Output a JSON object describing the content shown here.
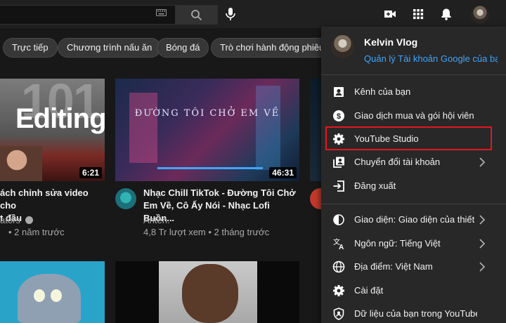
{
  "header": {
    "icons": [
      "keyboard-icon",
      "search-icon",
      "mic-icon",
      "create-video-icon",
      "apps-icon",
      "notifications-icon",
      "avatar"
    ]
  },
  "chips": [
    "Trực tiếp",
    "Chương trình nấu ăn",
    "Bóng đá",
    "Trò chơi hành động phiêu lưu"
  ],
  "videos": [
    {
      "thumb_text": "Editing",
      "thumb_big": "101",
      "duration": "6:21",
      "title_line1": "ách chỉnh sửa video cho",
      "title_line2": "t đầu",
      "channel": "ators",
      "meta": "• 2 năm trước"
    },
    {
      "thumb_text": "ĐƯỜNG TÔI CHỞ EM VỀ",
      "duration": "46:31",
      "title_line1": "Nhạc Chill TikTok - Đường Tôi Chở",
      "title_line2": "Em Về, Cô Ấy Nói - Nhạc Lofi Buồn...",
      "channel": "Anten.",
      "meta": "4,8 Tr lượt xem • 2 tháng trước"
    }
  ],
  "menu": {
    "name": "Kelvin Vlog",
    "manage": "Quản lý Tài khoản Google của bạn",
    "items": [
      {
        "label": "Kênh của bạn",
        "icon": "account-box-icon"
      },
      {
        "label": "Giao dịch mua và gói hội viên",
        "icon": "dollar-icon"
      },
      {
        "label": "YouTube Studio",
        "icon": "gear-icon"
      },
      {
        "label": "Chuyển đổi tài khoản",
        "icon": "switch-account-icon"
      },
      {
        "label": "Đăng xuất",
        "icon": "sign-out-icon"
      },
      {
        "label": "Giao diện: Giao diện của thiết bị",
        "icon": "appearance-icon"
      },
      {
        "label": "Ngôn ngữ: Tiếng Việt",
        "icon": "translate-icon"
      },
      {
        "label": "Địa điểm: Việt Nam",
        "icon": "globe-icon"
      },
      {
        "label": "Cài đặt",
        "icon": "settings-icon"
      },
      {
        "label": "Dữ liệu của bạn trong YouTube",
        "icon": "shield-icon"
      }
    ]
  },
  "colors": {
    "highlight": "#e0181f",
    "link": "#3ea6ff",
    "menu_bg": "#282828"
  }
}
